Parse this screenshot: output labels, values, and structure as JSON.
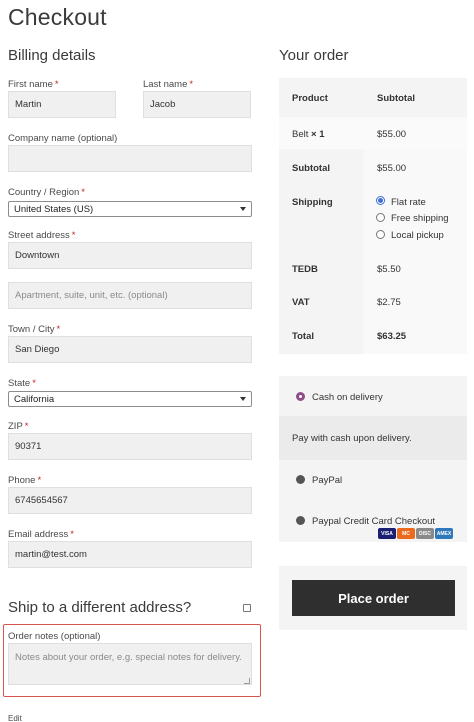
{
  "page": {
    "title": "Checkout"
  },
  "billing": {
    "title": "Billing details",
    "first_name": {
      "label": "First name",
      "value": "Martin"
    },
    "last_name": {
      "label": "Last name",
      "value": "Jacob"
    },
    "company": {
      "label": "Company name (optional)",
      "value": ""
    },
    "country": {
      "label": "Country / Region",
      "value": "United States (US)"
    },
    "street": {
      "label": "Street address",
      "value": "Downtown",
      "placeholder2": "Apartment, suite, unit, etc. (optional)"
    },
    "town": {
      "label": "Town / City",
      "value": "San Diego"
    },
    "state": {
      "label": "State",
      "value": "California"
    },
    "zip": {
      "label": "ZIP",
      "value": "90371"
    },
    "phone": {
      "label": "Phone",
      "value": "6745654567"
    },
    "email": {
      "label": "Email address",
      "value": "martin@test.com"
    },
    "required_mark": "*"
  },
  "shipping": {
    "title": "Ship to a different address?"
  },
  "notes": {
    "label": "Order notes (optional)",
    "placeholder": "Notes about your order, e.g. special notes for delivery."
  },
  "footer": {
    "edit": "Edit"
  },
  "order": {
    "title": "Your order",
    "col_product": "Product",
    "col_subtotal": "Subtotal",
    "item": {
      "name": "Belt",
      "qty": "× 1",
      "price": "$55.00"
    },
    "subtotal": {
      "label": "Subtotal",
      "value": "$55.00"
    },
    "shipping": {
      "label": "Shipping",
      "options": [
        {
          "label": "Flat rate",
          "selected": true
        },
        {
          "label": "Free shipping",
          "selected": false
        },
        {
          "label": "Local pickup",
          "selected": false
        }
      ]
    },
    "tedb": {
      "label": "TEDB",
      "value": "$5.50"
    },
    "vat": {
      "label": "VAT",
      "value": "$2.75"
    },
    "total": {
      "label": "Total",
      "value": "$63.25"
    }
  },
  "payment": {
    "cod": {
      "label": "Cash on delivery",
      "description": "Pay with cash upon delivery.",
      "selected": true
    },
    "paypal": {
      "label": "PayPal"
    },
    "paypal_cc": {
      "label": "Paypal Credit Card Checkout",
      "cards": [
        "VISA",
        "MC",
        "DISC",
        "AMEX"
      ]
    }
  },
  "place_order": {
    "label": "Place order"
  },
  "colors": {
    "accent_selected": "#8e4d86",
    "button_bg": "#2f2f2f",
    "highlight_border": "#d9534f"
  }
}
